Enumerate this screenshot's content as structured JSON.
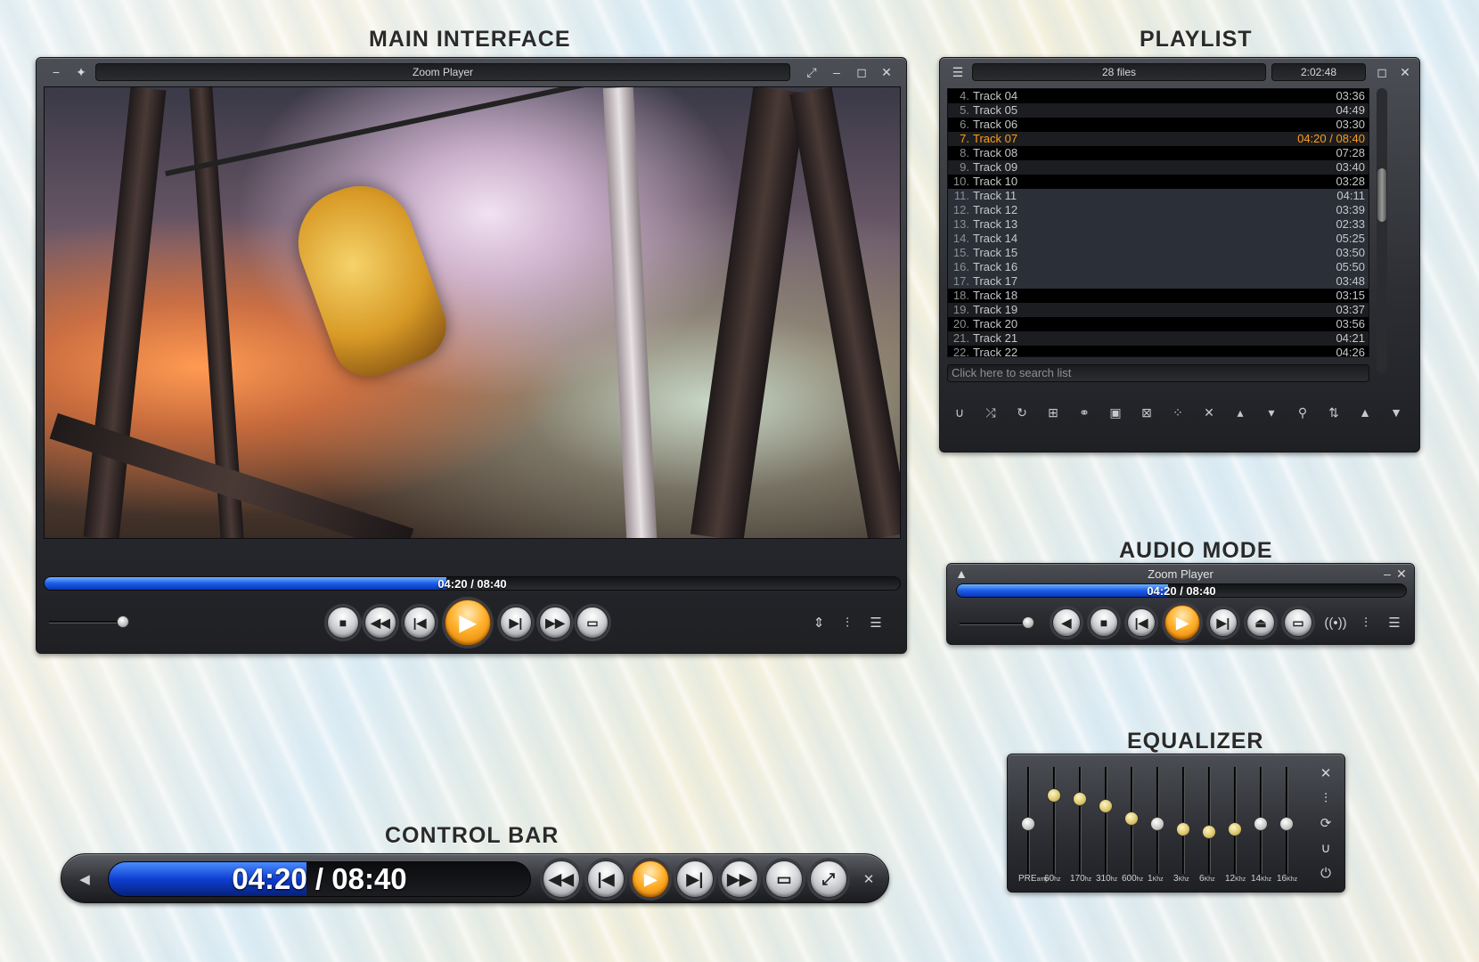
{
  "sections": {
    "main": "MAIN INTERFACE",
    "playlist": "PLAYLIST",
    "audio": "AUDIO MODE",
    "equalizer": "EQUALIZER",
    "control_bar": "CONTROL BAR"
  },
  "main_window": {
    "title": "Zoom Player",
    "time": "04:20 / 08:40",
    "progress": 0.47,
    "volume": 0.9
  },
  "playlist": {
    "file_count": "28 files",
    "total_time": "2:02:48",
    "search_placeholder": "Click here to search list",
    "rows": [
      {
        "num": "4.",
        "name": "Track 04",
        "dur": "03:36"
      },
      {
        "num": "5.",
        "name": "Track 05",
        "dur": "04:49"
      },
      {
        "num": "6.",
        "name": "Track 06",
        "dur": "03:30"
      },
      {
        "num": "7.",
        "name": "Track 07",
        "dur": "04:20 /  08:40"
      },
      {
        "num": "8.",
        "name": "Track 08",
        "dur": "07:28"
      },
      {
        "num": "9.",
        "name": "Track 09",
        "dur": "03:40"
      },
      {
        "num": "10.",
        "name": "Track 10",
        "dur": "03:28"
      },
      {
        "num": "11.",
        "name": "Track 11",
        "dur": "04:11"
      },
      {
        "num": "12.",
        "name": "Track 12",
        "dur": "03:39"
      },
      {
        "num": "13.",
        "name": "Track 13",
        "dur": "02:33"
      },
      {
        "num": "14.",
        "name": "Track 14",
        "dur": "05:25"
      },
      {
        "num": "15.",
        "name": "Track 15",
        "dur": "03:50"
      },
      {
        "num": "16.",
        "name": "Track 16",
        "dur": "05:50"
      },
      {
        "num": "17.",
        "name": "Track 17",
        "dur": "03:48"
      },
      {
        "num": "18.",
        "name": "Track 18",
        "dur": "03:15"
      },
      {
        "num": "19.",
        "name": "Track 19",
        "dur": "03:37"
      },
      {
        "num": "20.",
        "name": "Track 20",
        "dur": "03:56"
      },
      {
        "num": "21.",
        "name": "Track 21",
        "dur": "04:21"
      },
      {
        "num": "22.",
        "name": "Track 22",
        "dur": "04:26"
      }
    ]
  },
  "audio_window": {
    "title": "Zoom Player",
    "time": "04:20 / 08:40",
    "progress": 0.47
  },
  "equalizer": {
    "bands": [
      {
        "label": "PRE",
        "unit": "amp",
        "level": 0.5,
        "active": false
      },
      {
        "label": "60",
        "unit": "hz",
        "level": 0.79,
        "active": true
      },
      {
        "label": "170",
        "unit": "hz",
        "level": 0.75,
        "active": true
      },
      {
        "label": "310",
        "unit": "hz",
        "level": 0.68,
        "active": true
      },
      {
        "label": "600",
        "unit": "hz",
        "level": 0.55,
        "active": true
      },
      {
        "label": "1",
        "unit": "Khz",
        "level": 0.5,
        "active": false
      },
      {
        "label": "3",
        "unit": "Khz",
        "level": 0.45,
        "active": true
      },
      {
        "label": "6",
        "unit": "Khz",
        "level": 0.42,
        "active": true
      },
      {
        "label": "12",
        "unit": "Khz",
        "level": 0.45,
        "active": true
      },
      {
        "label": "14",
        "unit": "Khz",
        "level": 0.5,
        "active": false
      },
      {
        "label": "16",
        "unit": "Khz",
        "level": 0.5,
        "active": false
      }
    ]
  },
  "control_bar": {
    "time": "04:20 / 08:40",
    "progress": 0.47
  },
  "icons": {
    "play": "play-icon",
    "stop": "stop-icon",
    "rewind": "rewind-icon",
    "prev": "previous-icon",
    "next": "next-icon",
    "fast_forward": "fast-forward-icon",
    "open": "folder-open-icon"
  },
  "colors": {
    "accent": "#ff9d1a",
    "progress_blue": "#1b5de8"
  }
}
